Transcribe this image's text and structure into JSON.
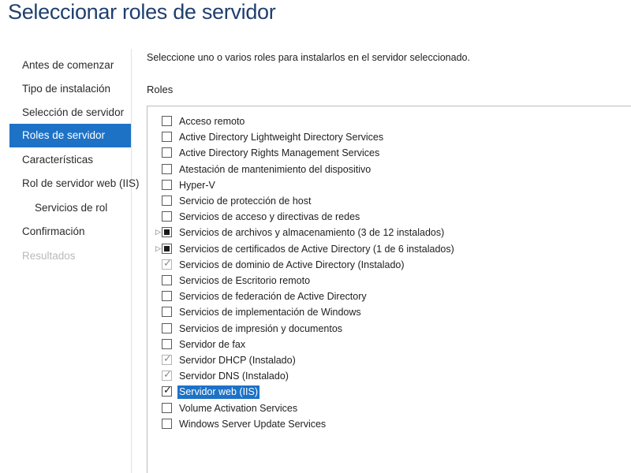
{
  "page": {
    "title": "Seleccionar roles de servidor"
  },
  "nav": {
    "items": [
      {
        "label": "Antes de comenzar",
        "state": "normal"
      },
      {
        "label": "Tipo de instalación",
        "state": "normal"
      },
      {
        "label": "Selección de servidor",
        "state": "normal"
      },
      {
        "label": "Roles de servidor",
        "state": "selected"
      },
      {
        "label": "Características",
        "state": "normal"
      },
      {
        "label": "Rol de servidor web (IIS)",
        "state": "normal"
      },
      {
        "label": "Servicios de rol",
        "state": "normal"
      },
      {
        "label": "Confirmación",
        "state": "normal"
      },
      {
        "label": "Resultados",
        "state": "disabled"
      }
    ]
  },
  "main": {
    "instruction": "Seleccione uno o varios roles para instalarlos en el servidor seleccionado.",
    "roles_heading": "Roles",
    "roles": [
      {
        "label": "Acceso remoto",
        "check": "unchecked"
      },
      {
        "label": "Active Directory Lightweight Directory Services",
        "check": "unchecked"
      },
      {
        "label": "Active Directory Rights Management Services",
        "check": "unchecked"
      },
      {
        "label": "Atestación de mantenimiento del dispositivo",
        "check": "unchecked"
      },
      {
        "label": "Hyper-V",
        "check": "unchecked"
      },
      {
        "label": "Servicio de protección de host",
        "check": "unchecked"
      },
      {
        "label": "Servicios de acceso y directivas de redes",
        "check": "unchecked"
      },
      {
        "label": "Servicios de archivos y almacenamiento (3 de 12 instalados)",
        "check": "partial",
        "expander": "▷"
      },
      {
        "label": "Servicios de certificados de Active Directory (1 de 6 instalados)",
        "check": "partial",
        "expander": "▷"
      },
      {
        "label": "Servicios de dominio de Active Directory (Instalado)",
        "check": "checked-disabled"
      },
      {
        "label": "Servicios de Escritorio remoto",
        "check": "unchecked"
      },
      {
        "label": "Servicios de federación de Active Directory",
        "check": "unchecked"
      },
      {
        "label": "Servicios de implementación de Windows",
        "check": "unchecked"
      },
      {
        "label": "Servicios de impresión y documentos",
        "check": "unchecked"
      },
      {
        "label": "Servidor de fax",
        "check": "unchecked"
      },
      {
        "label": "Servidor DHCP (Instalado)",
        "check": "checked-disabled"
      },
      {
        "label": "Servidor DNS (Instalado)",
        "check": "checked-disabled"
      },
      {
        "label": "Servidor web (IIS)",
        "check": "checked",
        "highlighted": true
      },
      {
        "label": "Volume Activation Services",
        "check": "unchecked"
      },
      {
        "label": "Windows Server Update Services",
        "check": "unchecked"
      }
    ]
  },
  "colors": {
    "title": "#1f3f6e",
    "selection": "#1d72c6"
  }
}
